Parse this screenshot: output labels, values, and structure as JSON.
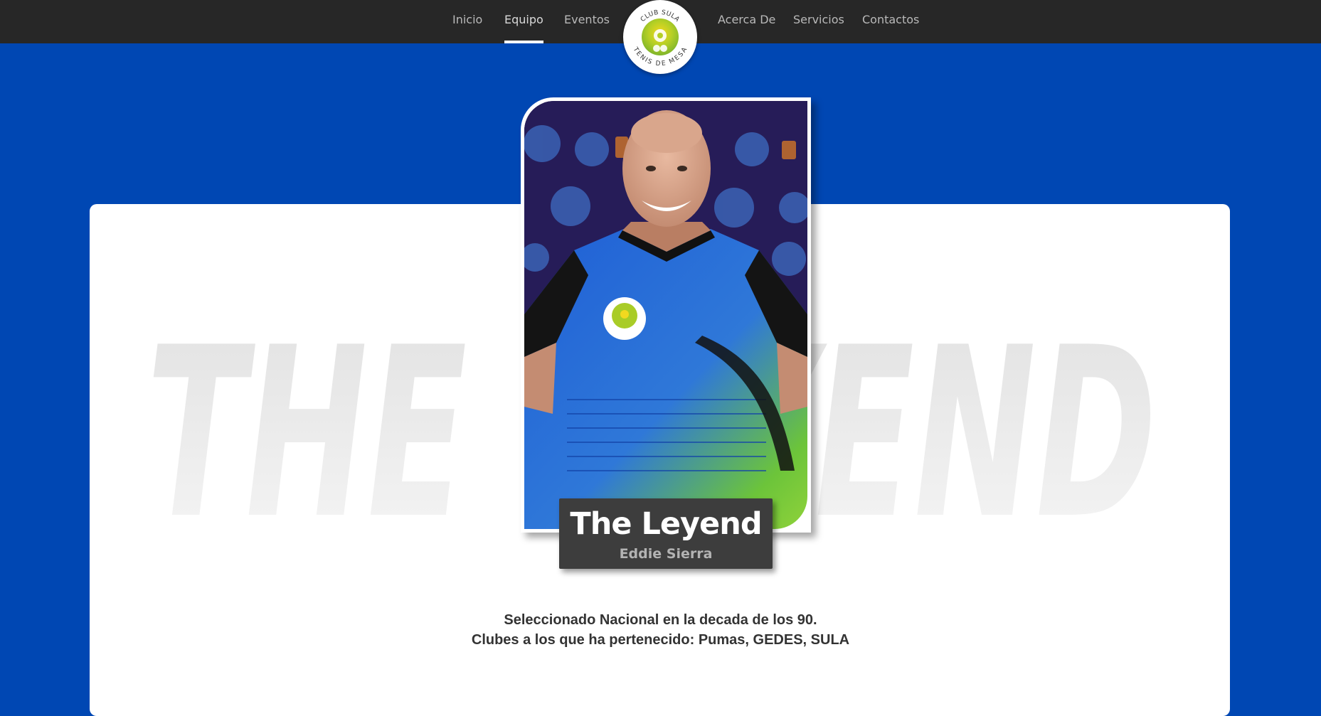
{
  "nav": {
    "items": [
      {
        "label": "Inicio",
        "active": false
      },
      {
        "label": "Equipo",
        "active": true
      },
      {
        "label": "Eventos",
        "active": false
      },
      {
        "label": "Acerca De",
        "active": false
      },
      {
        "label": "Servicios",
        "active": false
      },
      {
        "label": "Contactos",
        "active": false
      }
    ],
    "logo": {
      "top_text": "CLUB SULA",
      "bottom_text": "TENIS DE MESA"
    }
  },
  "profile": {
    "background_title": "THE LEYEND",
    "title": "The Leyend",
    "name": "Eddie Sierra",
    "bio_line1": "Seleccionado Nacional en la decada de los 90.",
    "bio_line2": "Clubes a los que ha pertenecido: Pumas, GEDES, SULA",
    "photo_description": "player-portrait"
  },
  "colors": {
    "page_background": "#0047b3",
    "topbar": "#272727",
    "card": "#ffffff",
    "nameplate": "#3d3d3d",
    "logo_green": "#9cc826",
    "logo_yellow": "#f0d21e"
  }
}
